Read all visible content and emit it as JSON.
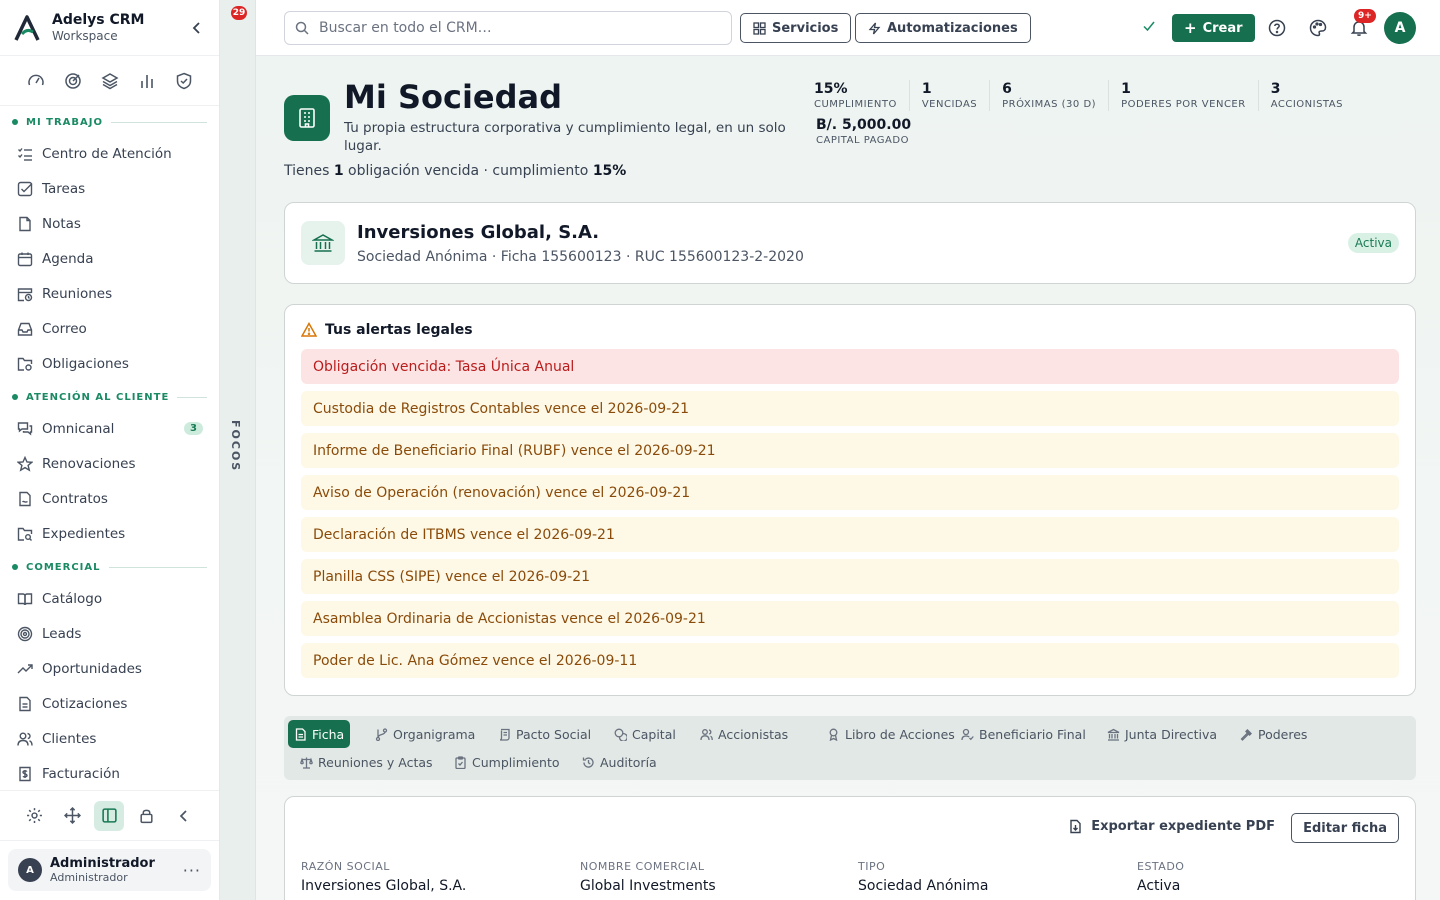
{
  "brand": {
    "name": "Adelys CRM",
    "sub": "Workspace"
  },
  "sidebar": {
    "sections": [
      {
        "label": "MI TRABAJO",
        "items": [
          {
            "label": "Centro de Atención",
            "icon": "list-check-icon"
          },
          {
            "label": "Tareas",
            "icon": "checkbox-icon"
          },
          {
            "label": "Notas",
            "icon": "file-icon"
          },
          {
            "label": "Agenda",
            "icon": "calendar-icon"
          },
          {
            "label": "Reuniones",
            "icon": "calendar-clock-icon"
          },
          {
            "label": "Correo",
            "icon": "inbox-icon"
          },
          {
            "label": "Obligaciones",
            "icon": "folder-gear-icon"
          }
        ]
      },
      {
        "label": "ATENCIÓN AL CLIENTE",
        "items": [
          {
            "label": "Omnicanal",
            "icon": "chat-icon",
            "badge": "3"
          },
          {
            "label": "Renovaciones",
            "icon": "star-icon"
          },
          {
            "label": "Contratos",
            "icon": "file-signature-icon"
          },
          {
            "label": "Expedientes",
            "icon": "folder-search-icon"
          }
        ]
      },
      {
        "label": "COMERCIAL",
        "items": [
          {
            "label": "Catálogo",
            "icon": "book-icon"
          },
          {
            "label": "Leads",
            "icon": "target-icon"
          },
          {
            "label": "Oportunidades",
            "icon": "trending-up-icon"
          },
          {
            "label": "Cotizaciones",
            "icon": "document-icon"
          },
          {
            "label": "Clientes",
            "icon": "users-icon"
          },
          {
            "label": "Facturación",
            "icon": "receipt-icon"
          }
        ]
      }
    ]
  },
  "user": {
    "initial": "A",
    "name": "Administrador",
    "role": "Administrador"
  },
  "focus": {
    "badge": "29",
    "label": "FOCOS"
  },
  "topbar": {
    "search_placeholder": "Buscar en todo el CRM…",
    "services_label": "Servicios",
    "automations_label": "Automatizaciones",
    "create_label": "Crear",
    "notif_badge": "9+",
    "avatar_initial": "A"
  },
  "hero": {
    "title": "Mi Sociedad",
    "subtitle": "Tu propia estructura corporativa y cumplimiento legal, en un solo lugar.",
    "summary_prefix": "Tienes ",
    "summary_count": "1",
    "summary_mid": " obligación vencida · cumplimiento ",
    "summary_pct": "15%"
  },
  "stats": [
    {
      "value": "15%",
      "label": "CUMPLIMIENTO"
    },
    {
      "value": "1",
      "label": "VENCIDAS"
    },
    {
      "value": "6",
      "label": "PRÓXIMAS (30 D)"
    },
    {
      "value": "1",
      "label": "PODERES POR VENCER"
    },
    {
      "value": "3",
      "label": "ACCIONISTAS"
    }
  ],
  "capital": {
    "value": "B/. 5,000.00",
    "label": "CAPITAL PAGADO"
  },
  "company": {
    "name": "Inversiones Global, S.A.",
    "meta": "Sociedad Anónima · Ficha 155600123 · RUC 155600123-2-2020",
    "status": "Activa"
  },
  "alerts": {
    "title": "Tus alertas legales",
    "items": [
      {
        "text": "Obligación vencida: Tasa Única Anual",
        "level": "danger"
      },
      {
        "text": "Custodia de Registros Contables vence el 2026-09-21",
        "level": "warn"
      },
      {
        "text": "Informe de Beneficiario Final (RUBF) vence el 2026-09-21",
        "level": "warn"
      },
      {
        "text": "Aviso de Operación (renovación) vence el 2026-09-21",
        "level": "warn"
      },
      {
        "text": "Declaración de ITBMS vence el 2026-09-21",
        "level": "warn"
      },
      {
        "text": "Planilla CSS (SIPE) vence el 2026-09-21",
        "level": "warn"
      },
      {
        "text": "Asamblea Ordinaria de Accionistas vence el 2026-09-21",
        "level": "warn"
      },
      {
        "text": "Poder de Lic. Ana Gómez vence el 2026-09-11",
        "level": "warn"
      }
    ]
  },
  "tabs": [
    {
      "label": "Ficha",
      "active": true
    },
    {
      "label": "Organigrama"
    },
    {
      "label": "Pacto Social"
    },
    {
      "label": "Capital"
    },
    {
      "label": "Accionistas"
    },
    {
      "label": "Libro de Acciones"
    },
    {
      "label": "Beneficiario Final"
    },
    {
      "label": "Junta Directiva"
    },
    {
      "label": "Poderes"
    },
    {
      "label": "Reuniones y Actas"
    },
    {
      "label": "Cumplimiento"
    },
    {
      "label": "Auditoría"
    }
  ],
  "ficha": {
    "export_label": "Exportar expediente PDF",
    "edit_label": "Editar ficha",
    "fields": [
      {
        "label": "RAZÓN SOCIAL",
        "value": "Inversiones Global, S.A."
      },
      {
        "label": "NOMBRE COMERCIAL",
        "value": "Global Investments"
      },
      {
        "label": "TIPO",
        "value": "Sociedad Anónima"
      },
      {
        "label": "ESTADO",
        "value": "Activa"
      }
    ]
  }
}
